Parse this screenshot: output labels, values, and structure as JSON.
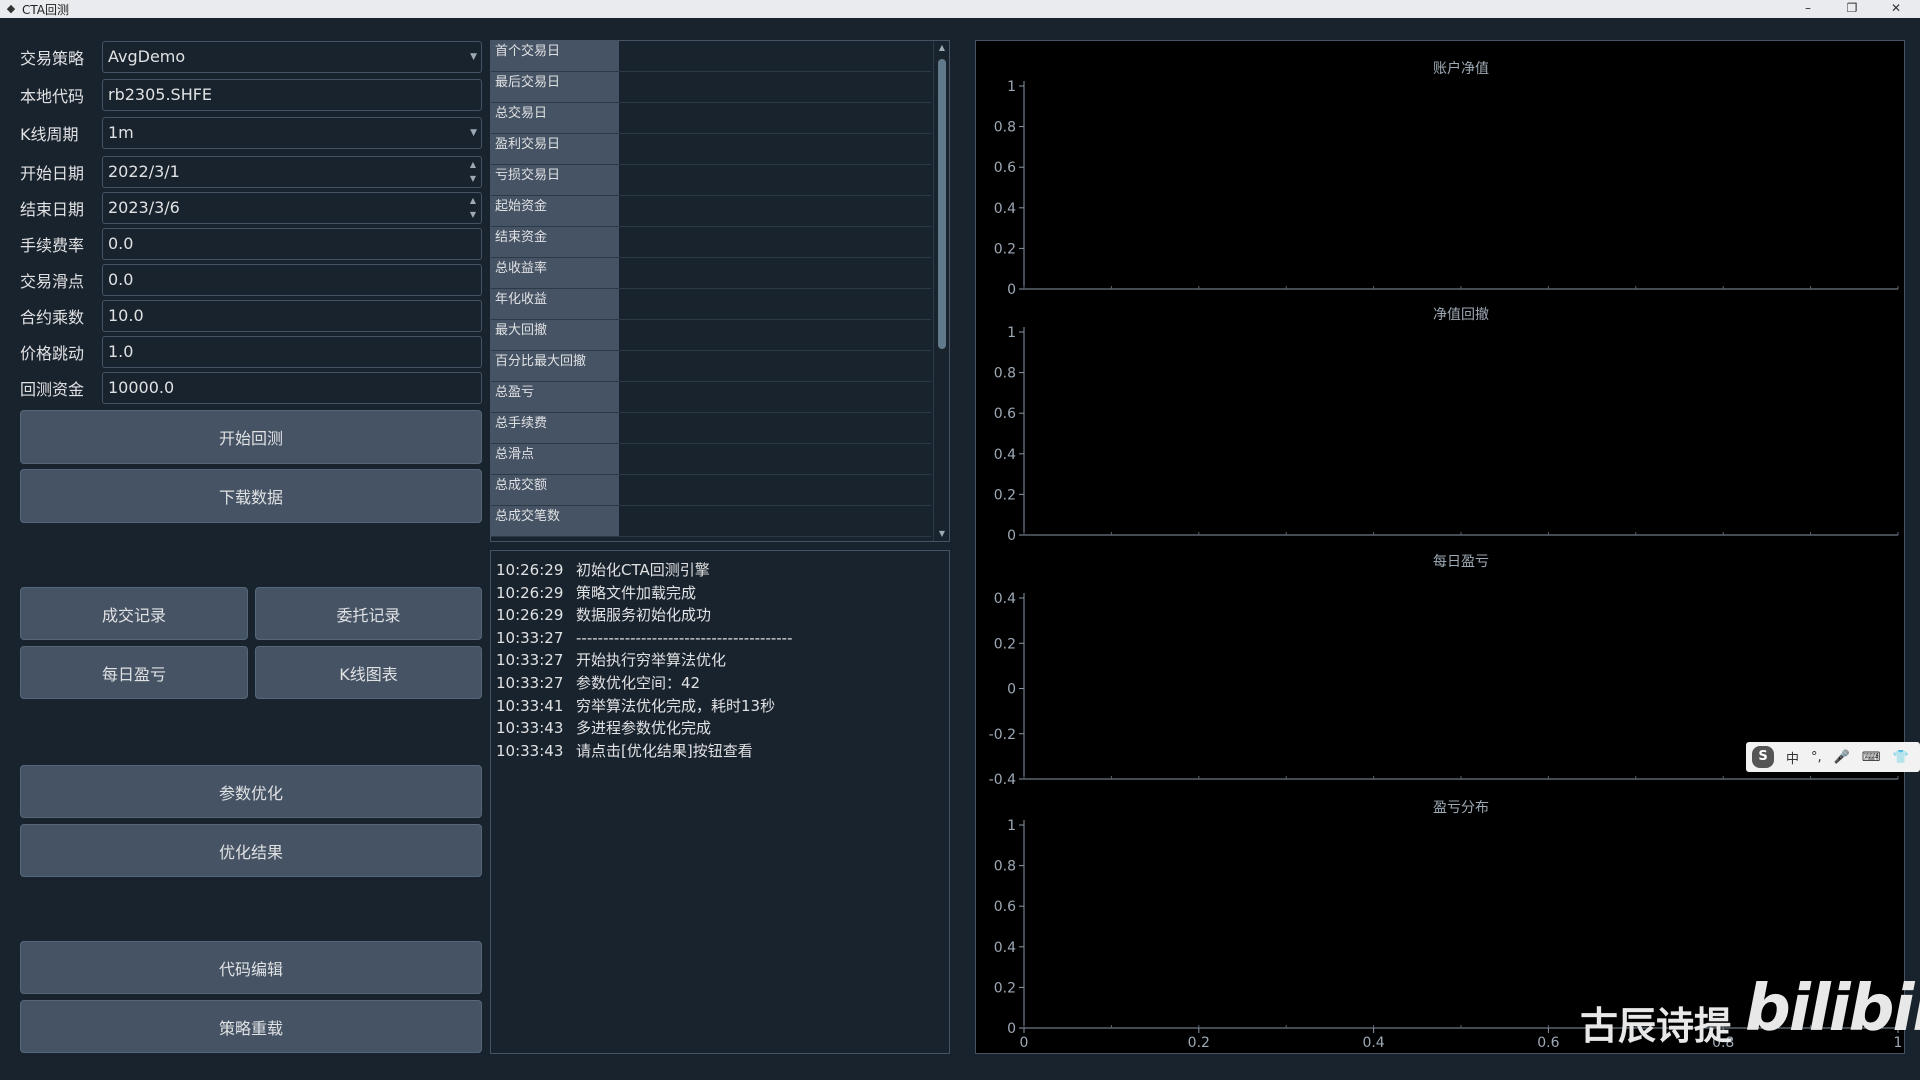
{
  "window": {
    "title": "CTA回测",
    "min_label": "–",
    "restore_label": "❐",
    "close_label": "✕"
  },
  "form": {
    "strategy": {
      "label": "交易策略",
      "value": "AvgDemo"
    },
    "symbol": {
      "label": "本地代码",
      "value": "rb2305.SHFE"
    },
    "interval": {
      "label": "K线周期",
      "value": "1m"
    },
    "start": {
      "label": "开始日期",
      "value": "2022/3/1"
    },
    "end": {
      "label": "结束日期",
      "value": "2023/3/6"
    },
    "rate": {
      "label": "手续费率",
      "value": "0.0"
    },
    "slippage": {
      "label": "交易滑点",
      "value": "0.0"
    },
    "size": {
      "label": "合约乘数",
      "value": "10.0"
    },
    "pricetick": {
      "label": "价格跳动",
      "value": "1.0"
    },
    "capital": {
      "label": "回测资金",
      "value": "10000.0"
    }
  },
  "buttons": {
    "start_backtest": "开始回测",
    "download": "下载数据",
    "trade_records": "成交记录",
    "order_records": "委托记录",
    "daily_pnl": "每日盈亏",
    "kline_chart": "K线图表",
    "optimize": "参数优化",
    "optimize_result": "优化结果",
    "code_edit": "代码编辑",
    "reload": "策略重载"
  },
  "stats": [
    {
      "label": "首个交易日",
      "value": ""
    },
    {
      "label": "最后交易日",
      "value": ""
    },
    {
      "label": "总交易日",
      "value": ""
    },
    {
      "label": "盈利交易日",
      "value": ""
    },
    {
      "label": "亏损交易日",
      "value": ""
    },
    {
      "label": "起始资金",
      "value": ""
    },
    {
      "label": "结束资金",
      "value": ""
    },
    {
      "label": "总收益率",
      "value": ""
    },
    {
      "label": "年化收益",
      "value": ""
    },
    {
      "label": "最大回撤",
      "value": ""
    },
    {
      "label": "百分比最大回撤",
      "value": ""
    },
    {
      "label": "总盈亏",
      "value": ""
    },
    {
      "label": "总手续费",
      "value": ""
    },
    {
      "label": "总滑点",
      "value": ""
    },
    {
      "label": "总成交额",
      "value": ""
    },
    {
      "label": "总成交笔数",
      "value": ""
    }
  ],
  "log": [
    {
      "time": "10:26:29",
      "msg": "初始化CTA回测引擎"
    },
    {
      "time": "10:26:29",
      "msg": "策略文件加载完成"
    },
    {
      "time": "10:26:29",
      "msg": "数据服务初始化成功"
    },
    {
      "time": "10:33:27",
      "msg": "----------------------------------------"
    },
    {
      "time": "10:33:27",
      "msg": "开始执行穷举算法优化"
    },
    {
      "time": "10:33:27",
      "msg": "参数优化空间：42"
    },
    {
      "time": "10:33:41",
      "msg": "穷举算法优化完成，耗时13秒"
    },
    {
      "time": "10:33:43",
      "msg": "多进程参数优化完成"
    },
    {
      "time": "10:33:43",
      "msg": "请点击[优化结果]按钮查看"
    }
  ],
  "chart_data": [
    {
      "type": "line",
      "title": "账户净值",
      "ylim": [
        0,
        1
      ],
      "yticks": [
        "1",
        "0.8",
        "0.6",
        "0.4",
        "0.2",
        "0"
      ],
      "series": []
    },
    {
      "type": "line",
      "title": "净值回撤",
      "ylim": [
        0,
        1
      ],
      "yticks": [
        "1",
        "0.8",
        "0.6",
        "0.4",
        "0.2",
        "0"
      ],
      "series": []
    },
    {
      "type": "bar",
      "title": "每日盈亏",
      "ylim": [
        -0.4,
        0.4
      ],
      "yticks": [
        "0.4",
        "0.2",
        "0",
        "-0.2",
        "-0.4"
      ],
      "series": []
    },
    {
      "type": "bar",
      "title": "盈亏分布",
      "ylim": [
        0,
        1
      ],
      "yticks": [
        "1",
        "0.8",
        "0.6",
        "0.4",
        "0.2",
        "0"
      ],
      "xlim": [
        0,
        1
      ],
      "xticks": [
        "0",
        "0.2",
        "0.4",
        "0.6",
        "0.8",
        "1"
      ],
      "series": []
    }
  ],
  "watermark": {
    "author": "古辰诗提",
    "logo": "bilibili"
  },
  "ime": {
    "logo": "S",
    "lang": "中",
    "punct": "°,",
    "mic": "🎤",
    "keyboard": "⌨",
    "shirt": "👕"
  }
}
